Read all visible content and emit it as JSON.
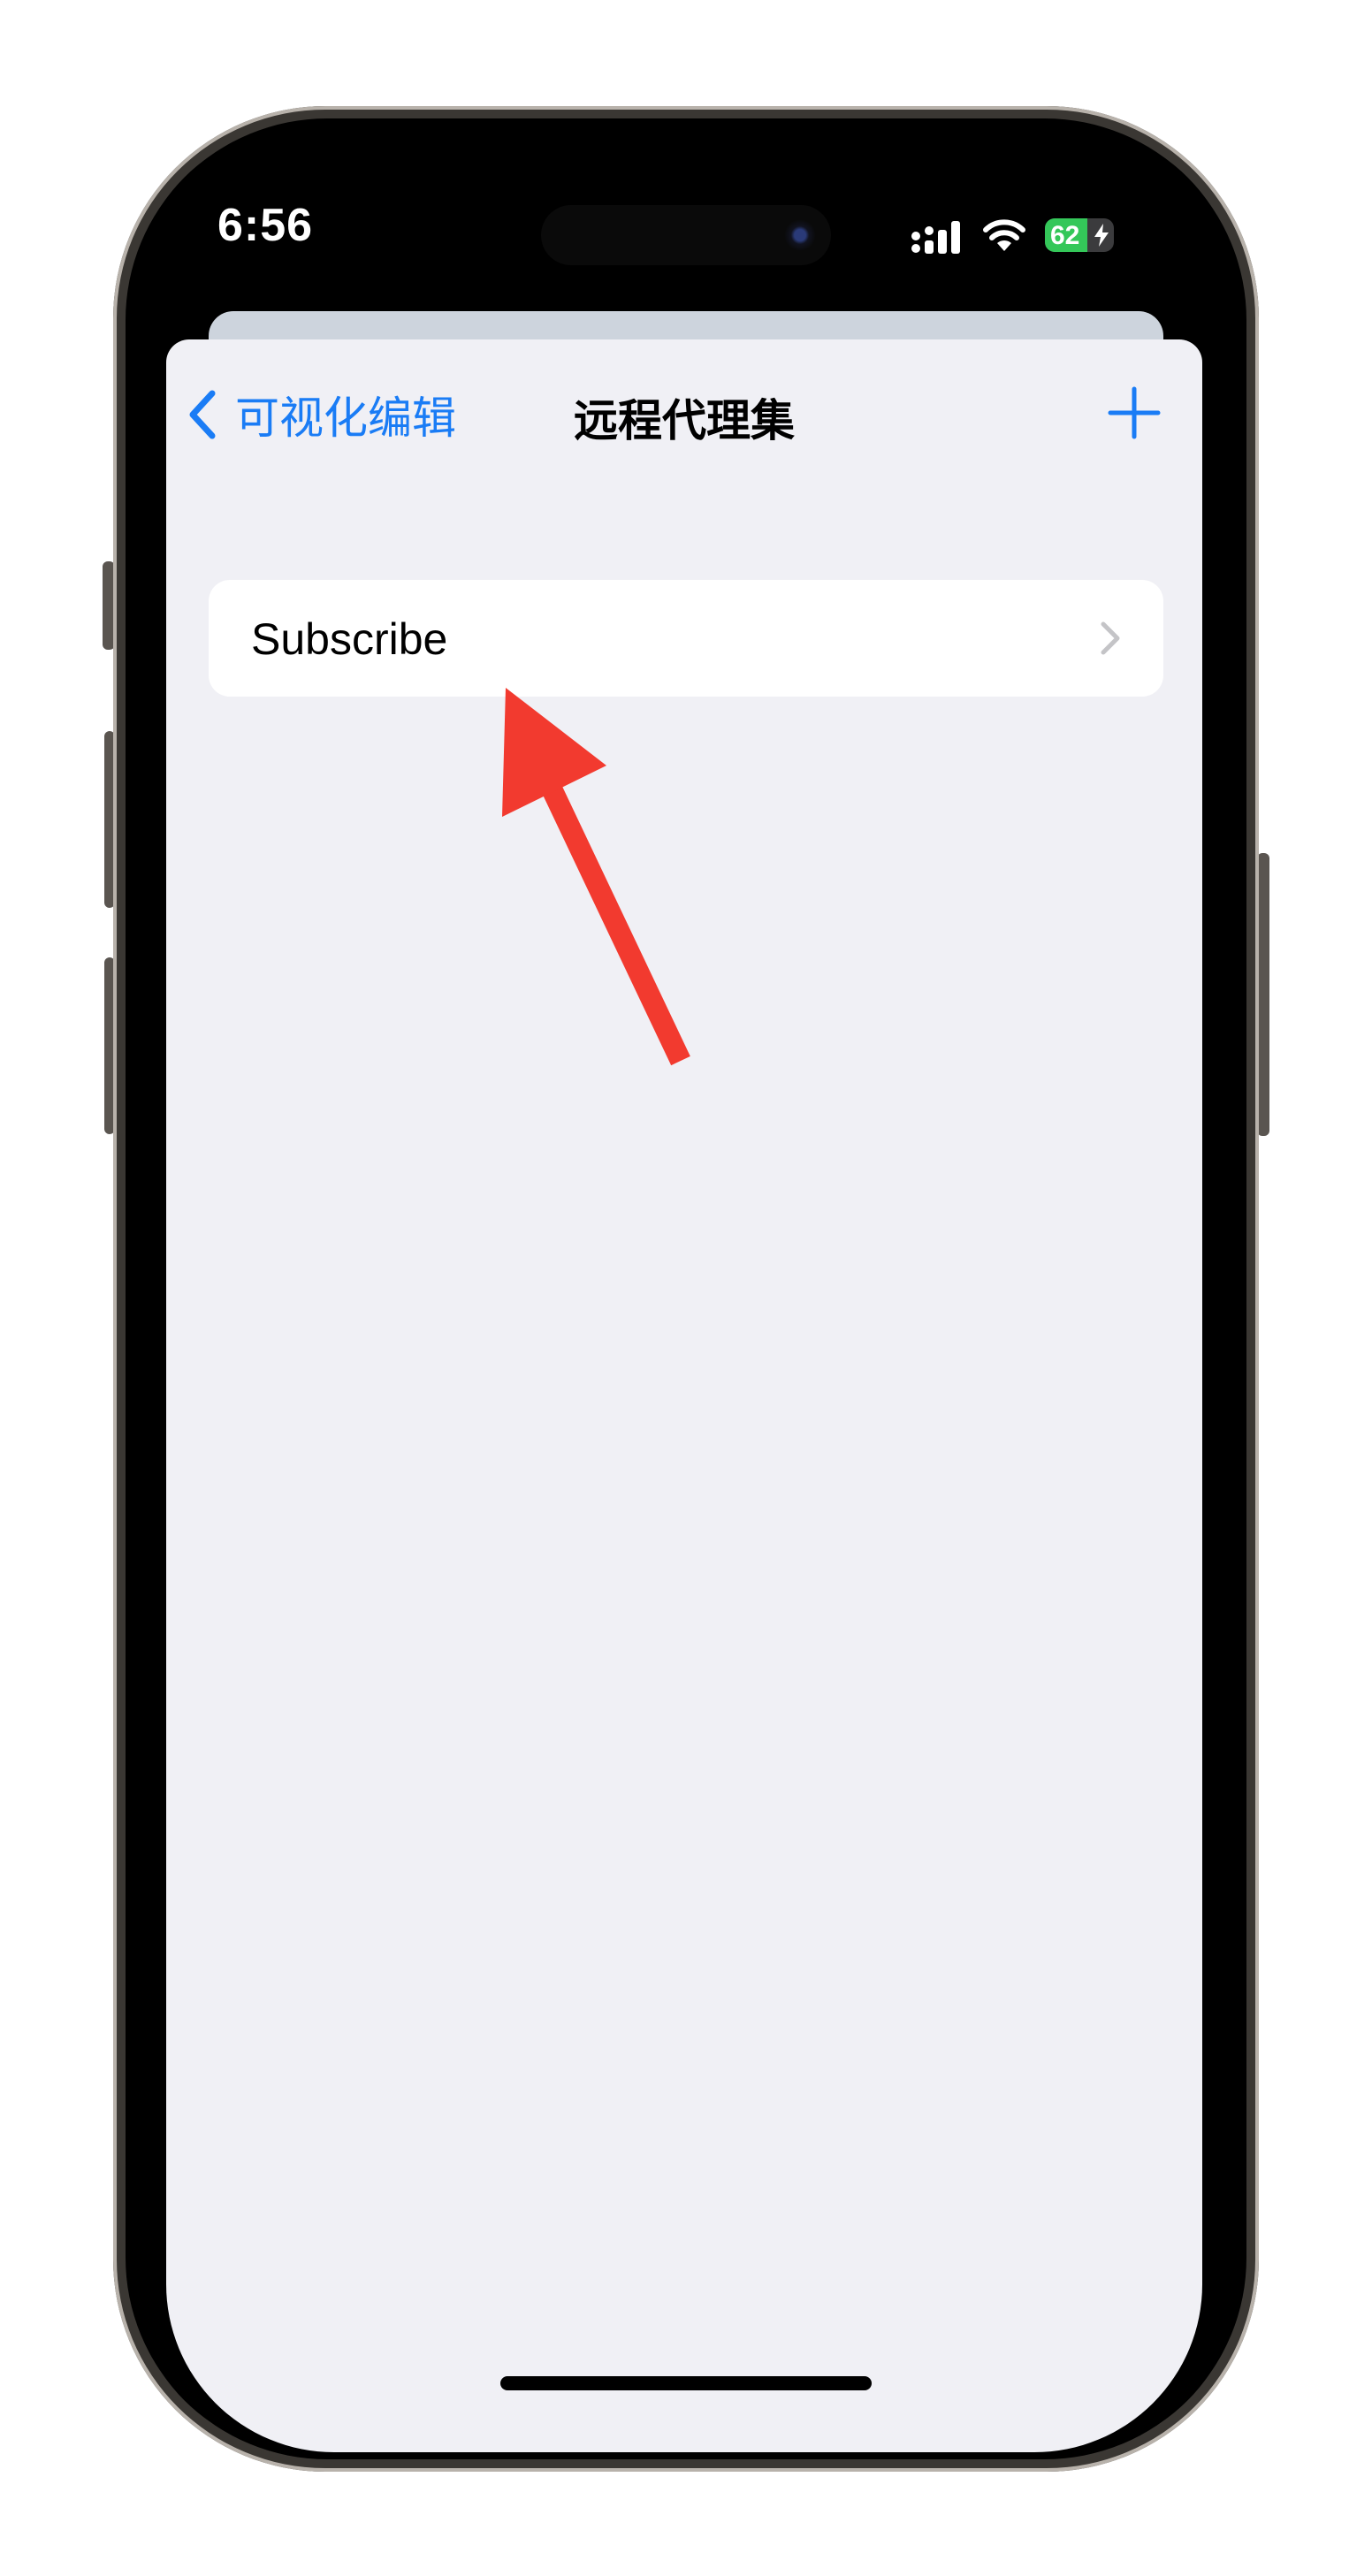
{
  "status_bar": {
    "time": "6:56",
    "battery_percent": "62",
    "battery_level": 0.62,
    "battery_color": "#34c759",
    "icons": [
      "signal-icon",
      "wifi-icon",
      "battery-charging-icon"
    ]
  },
  "nav": {
    "back_label": "可视化编辑",
    "title": "远程代理集",
    "add_icon": "plus-icon",
    "accent_color": "#1a7cf5"
  },
  "list": {
    "items": [
      {
        "label": "Subscribe",
        "icon": "chevron-right-icon"
      }
    ]
  },
  "annotation": {
    "arrow_color": "#f23a2f"
  }
}
